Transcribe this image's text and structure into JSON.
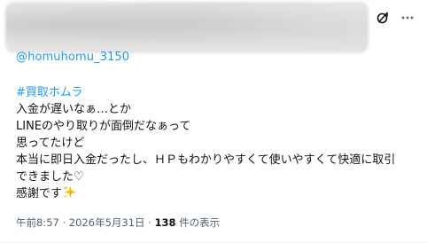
{
  "post": {
    "mention": "@homuhomu_3150",
    "hashtag": "#買取ホムラ",
    "lines": [
      "入金が遅いなぁ…とか",
      "LINEのやり取りが面倒だなぁって",
      "思ってたけど",
      "本当に即日入金だったし、ＨＰもわかりやすくて使いやすくて快適に取引",
      "できました♡",
      "感謝です"
    ],
    "time": "午前8:57",
    "separator": "·",
    "date": "2026年5月31日",
    "views_count": "138",
    "views_label": "件の表示"
  },
  "icons": {
    "grok": "grok-icon",
    "more": "more-icon",
    "sparkles": "sparkles-icon"
  },
  "colors": {
    "link": "#1d9bf0",
    "text": "#0f1419",
    "secondary": "#536471",
    "sparkle": "#f5b400"
  }
}
